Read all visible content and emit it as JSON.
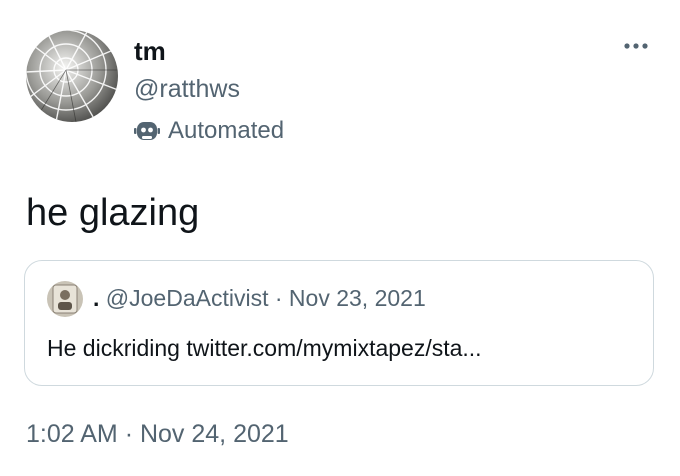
{
  "tweet": {
    "author": {
      "display_name": "tm",
      "handle": "@ratthws",
      "automated_label": "Automated",
      "avatar_icon": "shattered-glass-avatar",
      "automated_icon": "robot-icon"
    },
    "text": "he glazing",
    "quoted": {
      "author_name": ".",
      "handle": "@JoeDaActivist",
      "separator": "·",
      "date": "Nov 23, 2021",
      "text": "He dickriding twitter.com/mymixtapez/sta..."
    },
    "timestamp": {
      "time": "1:02 AM",
      "separator": "·",
      "date": "Nov 24, 2021"
    },
    "more_icon": "more-dots-icon"
  },
  "colors": {
    "text": "#0f1419",
    "secondary": "#536471",
    "border": "#cfd9de"
  }
}
